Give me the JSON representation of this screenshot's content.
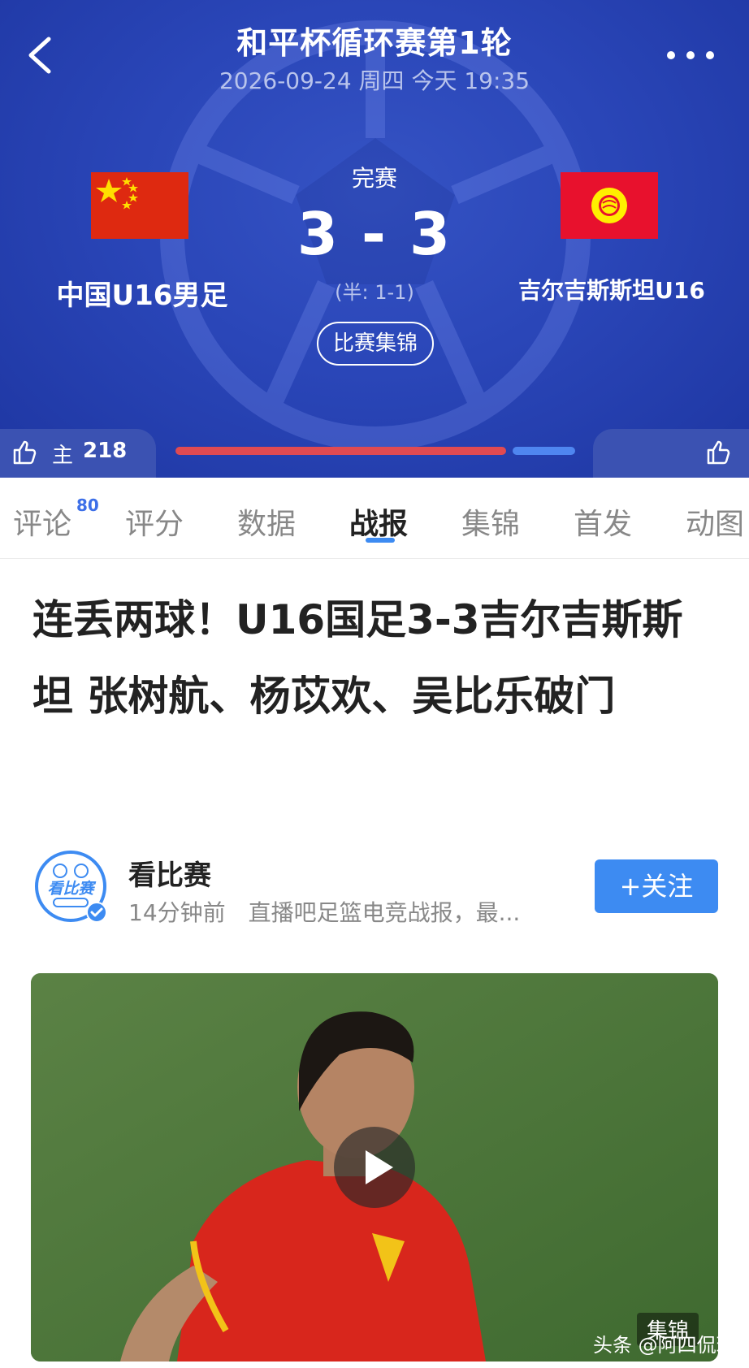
{
  "header": {
    "title": "和平杯循环赛第1轮",
    "datetime": "2026-09-24 周四 今天 19:35",
    "status": "完赛",
    "score": "3 - 3",
    "half_score": "(半: 1-1)",
    "highlights_label": "比赛集锦",
    "home_team": "中国U16男足",
    "away_team": "吉尔吉斯斯坦U16",
    "home_vote_label": "主",
    "home_vote_count": "218",
    "home_vote_share": 0.84,
    "colors": {
      "hero": "#2a46b8",
      "home_bar": "#e04a52",
      "away_bar": "#4f86f0"
    }
  },
  "tabs": [
    {
      "label": "评论",
      "badge": "80"
    },
    {
      "label": "评分"
    },
    {
      "label": "数据"
    },
    {
      "label": "战报",
      "active": true
    },
    {
      "label": "集锦"
    },
    {
      "label": "首发"
    },
    {
      "label": "动图"
    }
  ],
  "article": {
    "headline": "连丢两球！U16国足3-3吉尔吉斯斯坦 张树航、杨苡欢、吴比乐破门",
    "author": {
      "name": "看比赛",
      "avatar_text": "看比赛",
      "meta": "14分钟前　直播吧足篮电竞战报，最..."
    },
    "follow_label": "+关注",
    "video_badge": "集锦"
  },
  "watermark": "头条 @阿四侃球",
  "icons": {
    "back": "chevron-left-icon",
    "more": "more-dots-icon",
    "like": "thumbs-up-icon",
    "play": "play-icon",
    "verified": "verified-check-icon"
  },
  "accent": "#3d8bf2"
}
